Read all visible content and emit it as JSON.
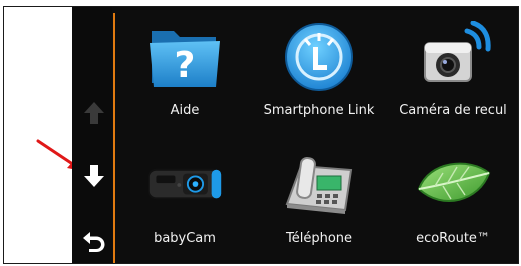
{
  "menu": {
    "items": [
      {
        "label": "Aide",
        "icon": "help-folder-icon"
      },
      {
        "label": "Smartphone Link",
        "icon": "smartphone-link-icon"
      },
      {
        "label": "Caméra de recul",
        "icon": "backup-camera-icon"
      },
      {
        "label": "babyCam",
        "icon": "babycam-icon"
      },
      {
        "label": "Téléphone",
        "icon": "telephone-icon"
      },
      {
        "label": "ecoRoute™",
        "icon": "ecoroute-leaf-icon"
      }
    ]
  },
  "nav": {
    "up": {
      "icon": "arrow-up-icon",
      "state": "disabled"
    },
    "down": {
      "icon": "arrow-down-icon",
      "state": "enabled"
    },
    "back": {
      "icon": "back-arrow-icon"
    }
  },
  "colors": {
    "accent": "#e07a10",
    "background": "#0d0d0d",
    "annotation_arrow": "#e01818"
  }
}
